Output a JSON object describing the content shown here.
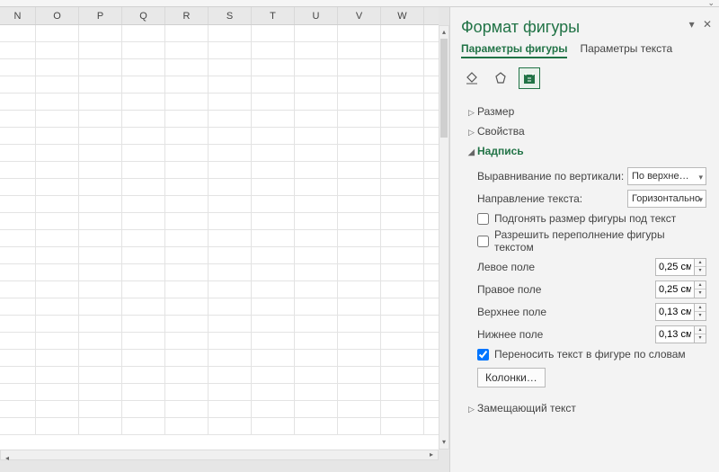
{
  "columns": [
    "N",
    "O",
    "P",
    "Q",
    "R",
    "S",
    "T",
    "U",
    "V",
    "W"
  ],
  "pane": {
    "title": "Формат фигуры",
    "tabs": {
      "shape": "Параметры фигуры",
      "text": "Параметры текста"
    },
    "sections": {
      "size": "Размер",
      "props": "Свойства",
      "textbox": "Надпись",
      "alttext": "Замещающий текст"
    },
    "textbox": {
      "valign_label": "Выравнивание по вертикали:",
      "valign_value": "По верхне…",
      "textdir_label": "Направление текста:",
      "textdir_value": "Горизонтально",
      "autofit_label": "Подгонять размер фигуры под текст",
      "overflow_label": "Разрешить переполнение фигуры текстом",
      "left_label": "Левое поле",
      "right_label": "Правое поле",
      "top_label": "Верхнее поле",
      "bottom_label": "Нижнее поле",
      "left_val": "0,25 см",
      "right_val": "0,25 см",
      "top_val": "0,13 см",
      "bottom_val": "0,13 см",
      "wrap_label": "Переносить текст в фигуре по словам",
      "columns_btn": "Колонки…"
    }
  }
}
